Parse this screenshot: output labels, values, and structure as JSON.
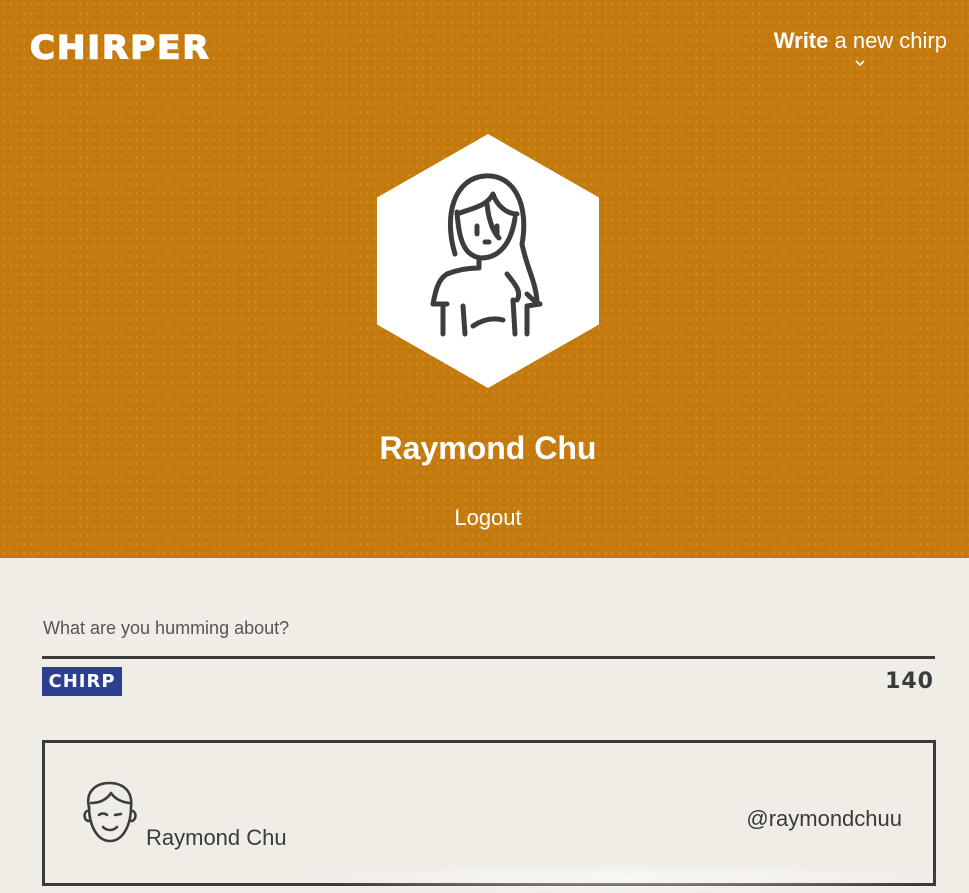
{
  "header": {
    "logo": "CHIRPER",
    "write_strong": "Write",
    "write_rest": " a new chirp"
  },
  "profile": {
    "name": "Raymond Chu",
    "logout_label": "Logout"
  },
  "compose": {
    "placeholder": "What are you humming about?",
    "value": "",
    "submit_label": "CHIRP",
    "chars_remaining": "140"
  },
  "chirps": [
    {
      "name": "Raymond Chu",
      "handle": "@raymondchuu"
    }
  ],
  "colors": {
    "hero_bg": "#c47a0d",
    "page_bg": "#f0ede7",
    "button_bg": "#2d3f8f",
    "text_dark": "#3a3a3a"
  },
  "icons": {
    "profile_avatar": "woman-avatar-icon",
    "chirp_avatar": "boy-avatar-icon",
    "write_dropdown": "chevron-down-icon"
  }
}
